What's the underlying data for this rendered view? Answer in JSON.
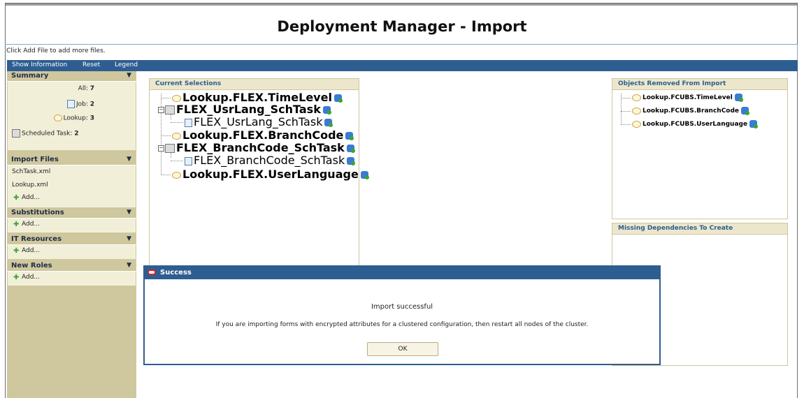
{
  "page": {
    "title": "Deployment Manager - Import",
    "hint": "Click Add File to add more files."
  },
  "menu": {
    "show_information": "Show Information",
    "reset": "Reset",
    "legend": "Legend"
  },
  "sidebar": {
    "summary": {
      "title": "Summary",
      "all_label": "All:",
      "all_count": "7",
      "job_label": "Job:",
      "job_count": "2",
      "lookup_label": "Lookup:",
      "lookup_count": "3",
      "sched_label": "Scheduled Task:",
      "sched_count": "2"
    },
    "import_files": {
      "title": "Import Files",
      "files": [
        "SchTask.xml",
        "Lookup.xml"
      ],
      "add": "Add..."
    },
    "substitutions": {
      "title": "Substitutions",
      "add": "Add..."
    },
    "it_resources": {
      "title": "IT Resources",
      "add": "Add..."
    },
    "new_roles": {
      "title": "New Roles",
      "add": "Add..."
    }
  },
  "current_selections": {
    "title": "Current Selections",
    "items": [
      {
        "label": "Lookup.FLEX.TimeLevel"
      },
      {
        "label": "FLEX_UsrLang_SchTask"
      },
      {
        "label": "FLEX_UsrLang_SchTask"
      },
      {
        "label": "Lookup.FLEX.BranchCode"
      },
      {
        "label": "FLEX_BranchCode_SchTask"
      },
      {
        "label": "FLEX_BranchCode_SchTask"
      },
      {
        "label": "Lookup.FLEX.UserLanguage"
      }
    ]
  },
  "objects_removed": {
    "title": "Objects Removed From Import",
    "items": [
      {
        "label": "Lookup.FCUBS.TimeLevel"
      },
      {
        "label": "Lookup.FCUBS.BranchCode"
      },
      {
        "label": "Lookup.FCUBS.UserLanguage"
      }
    ]
  },
  "missing_dependencies": {
    "title": "Missing Dependencies To Create"
  },
  "dialog": {
    "title": "Success",
    "message": "Import successful",
    "detail": "If you are importing forms with encrypted attributes for a clustered configuration, then restart all nodes of the cluster.",
    "ok": "OK"
  },
  "colors": {
    "menubar": "#2e5e91",
    "sidebar": "#cfc79d",
    "panel_header_text": "#2e5e91",
    "dialog_border": "#2e5e91"
  }
}
